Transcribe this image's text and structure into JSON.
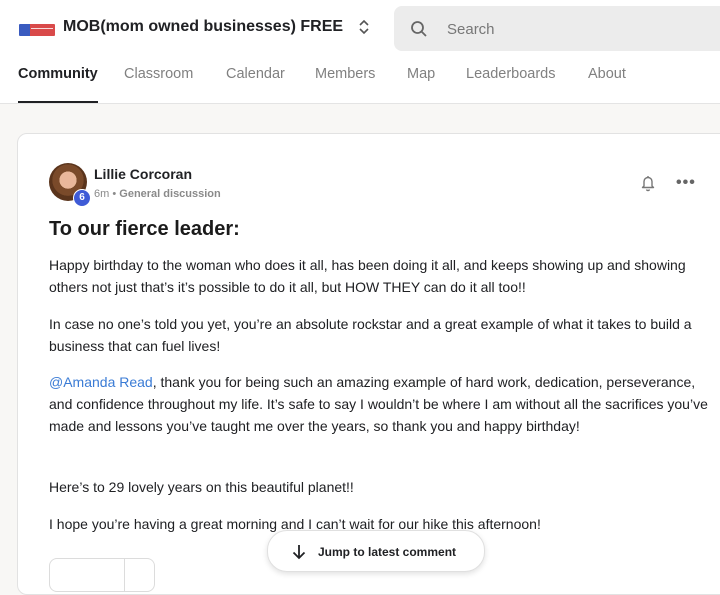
{
  "header": {
    "group_name": "MOB(mom owned businesses) FREE",
    "logo_text": "MOM OWNED BUSINESSES",
    "search_placeholder": "Search"
  },
  "tabs": [
    {
      "label": "Community",
      "active": true
    },
    {
      "label": "Classroom",
      "active": false
    },
    {
      "label": "Calendar",
      "active": false
    },
    {
      "label": "Members",
      "active": false
    },
    {
      "label": "Map",
      "active": false
    },
    {
      "label": "Leaderboards",
      "active": false
    },
    {
      "label": "About",
      "active": false
    }
  ],
  "post": {
    "author": "Lillie Corcoran",
    "level": "6",
    "time": "6m",
    "separator": "•",
    "category": "General discussion",
    "title": "To our fierce leader:",
    "paragraphs": {
      "p1": "Happy birthday to the woman who does it all, has been doing it all, and keeps showing up and showing others not just that’s it’s possible to do it all, but HOW THEY can do it all too!!",
      "p2": "In case no one’s told you yet, you’re an absolute rockstar and a great example of what it takes to build a business that can fuel lives!",
      "p3_mention": "@Amanda Read",
      "p3_rest": ", thank you for being such an amazing example of hard work, dedication, perseverance, and confidence throughout my life. It’s safe to say I wouldn’t be where I am without all the sacrifices you’ve made and lessons you’ve taught me over the years, so thank you and happy birthday!",
      "p4": "Here’s to 29 lovely years on this beautiful planet!!",
      "p5": "I hope you’re having a great morning and I can’t wait for our hike this afternoon!"
    }
  },
  "jump_button": {
    "label": "Jump to latest comment"
  },
  "icons": {
    "switcher": "chevron-up-down-icon",
    "search": "search-icon",
    "bell": "bell-off-icon",
    "more": "more-horizontal-icon",
    "jump": "arrow-down-icon"
  },
  "colors": {
    "accent": "#3f5bd6",
    "mention": "#3a7bd5",
    "text": "#202124",
    "muted": "#808080"
  }
}
